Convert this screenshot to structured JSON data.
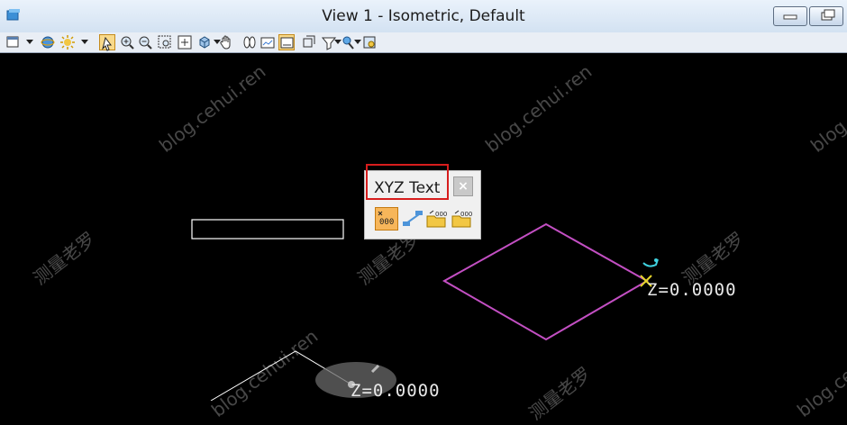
{
  "window": {
    "title": "View 1 - Isometric, Default"
  },
  "toolbar": {
    "tools": [
      "view-attributes-icon",
      "display-style-icon",
      "update-view-icon",
      "zoom-in-icon",
      "zoom-out-icon",
      "window-area-icon",
      "fit-view-icon",
      "rotate-view-icon",
      "pan-view-icon",
      "view-previous-icon",
      "view-next-icon",
      "copy-view-icon",
      "clip-volume-icon",
      "clip-mask-icon",
      "camera-icon",
      "view-toggle-icon"
    ]
  },
  "palette": {
    "title": "XYZ Text",
    "close_label": "×",
    "tools": [
      "place-coordinates-icon",
      "export-coordinates-icon",
      "import-coordinates-icon",
      "export-file-icon"
    ]
  },
  "viewport": {
    "label_1": "Z=0.0000",
    "label_2": "Z=0.0000"
  },
  "watermarks": [
    "blog.cehui.ren",
    "blog.cehui.ren",
    "blog.cehui.r",
    "测量老罗",
    "测量老罗",
    "测量老罗",
    "blog.cehui.ren",
    "测量老罗",
    "blog.cehui.ren"
  ],
  "colors": {
    "shape_magenta": "#c34fc3",
    "marker_yellow": "#e4d42b",
    "cursor_cyan": "#3fd3e0",
    "palette_red_highlight": "#d71d1d"
  }
}
